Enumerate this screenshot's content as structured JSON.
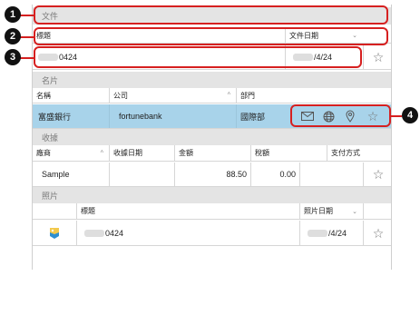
{
  "sections": {
    "document": "文件",
    "business_card": "名片",
    "receipt": "收據",
    "photo": "照片"
  },
  "document": {
    "headers": {
      "title": "標題",
      "date": "文件日期"
    },
    "row": {
      "title_suffix": "0424",
      "date_suffix": "/4/24"
    }
  },
  "card": {
    "headers": {
      "name": "名稱",
      "company": "公司",
      "department": "部門"
    },
    "row": {
      "name": "富盛銀行",
      "company": "fortunebank",
      "department": "國際部"
    }
  },
  "receipt": {
    "headers": {
      "vendor": "廠商",
      "date": "收據日期",
      "amount": "金額",
      "tax": "稅額",
      "payment": "支付方式"
    },
    "row": {
      "vendor": "Sample",
      "amount": "88.50",
      "tax": "0.00"
    }
  },
  "photo": {
    "headers": {
      "title": "標題",
      "date": "照片日期"
    },
    "row": {
      "title_suffix": "0424",
      "date_suffix": "/4/24"
    }
  },
  "icons": {
    "favorite": "★-outline",
    "mail": "mail-icon",
    "web": "globe-icon",
    "map": "map-pin-icon"
  },
  "callouts": [
    "1",
    "2",
    "3",
    "4"
  ],
  "colors": {
    "selected_row": "#a8d3ea",
    "section_band": "#e4e4e4",
    "callout": "#d62020"
  }
}
